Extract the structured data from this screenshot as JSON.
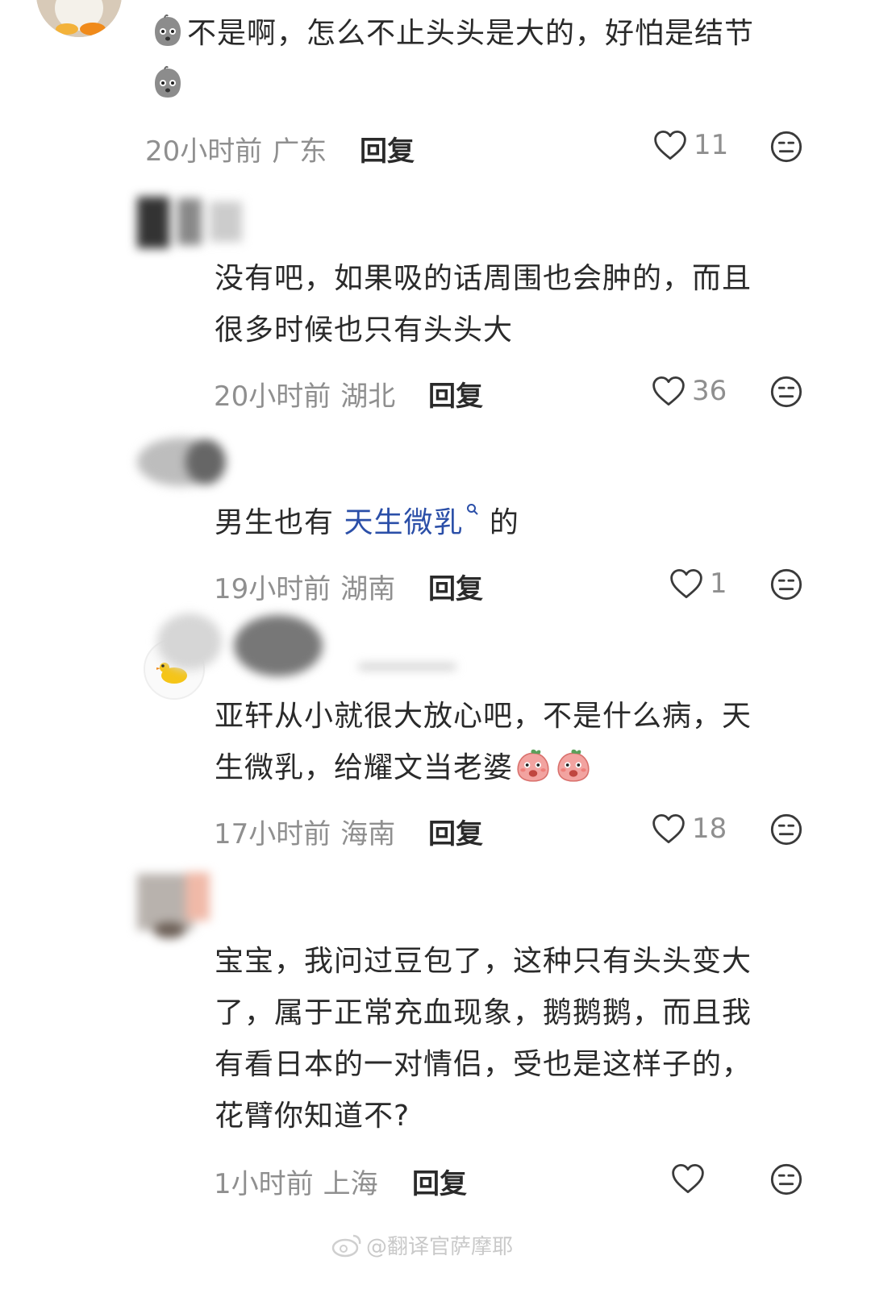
{
  "comments": [
    {
      "text_lines": [
        "不是啊，怎么不止头头是大的，好怕是结节"
      ],
      "time": "20小时前",
      "location": "广东",
      "reply_label": "回复",
      "likes": "11"
    },
    {
      "text_lines": [
        "没有吧，如果吸的话周围也会肿的，而且",
        "很多时候也只有头头大"
      ],
      "time": "20小时前",
      "location": "湖北",
      "reply_label": "回复",
      "likes": "36"
    },
    {
      "text_prefix": "男生也有 ",
      "link_text": "天生微乳",
      "text_suffix": " 的",
      "time": "19小时前",
      "location": "湖南",
      "reply_label": "回复",
      "likes": "1"
    },
    {
      "text_lines": [
        "亚轩从小就很大放心吧，不是什么病，天",
        "生微乳，给耀文当老婆"
      ],
      "time": "17小时前",
      "location": "海南",
      "reply_label": "回复",
      "likes": "18"
    },
    {
      "text_lines": [
        "宝宝，我问过豆包了，这种只有头头变大",
        "了，属于正常充血现象，鹅鹅鹅，而且我",
        "有看日本的一对情侣，受也是这样子的，",
        "花臂你知道不?"
      ],
      "time": "1小时前",
      "location": "上海",
      "reply_label": "回复",
      "likes": ""
    }
  ],
  "icons": {
    "like": "heart-outline-icon",
    "face": "neutral-face-icon",
    "search": "search-icon"
  },
  "watermark": "@翻译官萨摩耶",
  "colors": {
    "link": "#2b4fa8",
    "meta": "#8f8f8f",
    "text": "#2a2a2a"
  }
}
